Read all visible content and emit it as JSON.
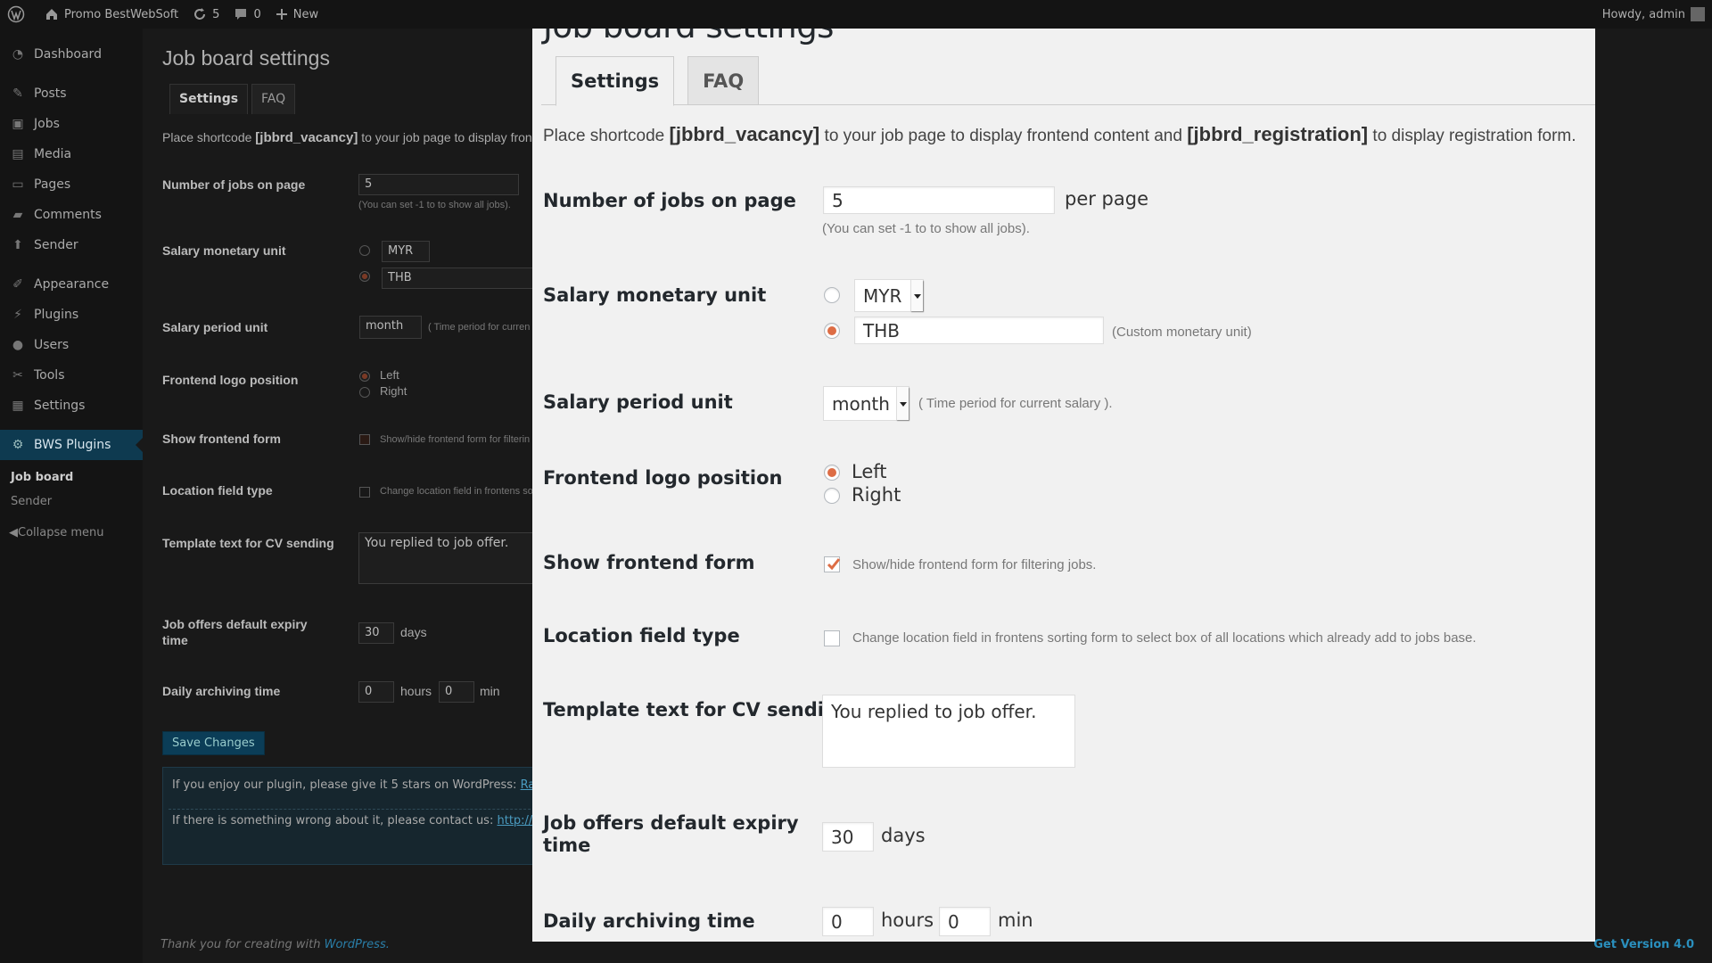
{
  "adminbar": {
    "site_name": "Promo BestWebSoft",
    "updates_count": "5",
    "comments_count": "0",
    "new_label": "New",
    "howdy": "Howdy, admin"
  },
  "sidebar": {
    "items": [
      {
        "label": "Dashboard"
      },
      {
        "label": "Posts"
      },
      {
        "label": "Jobs"
      },
      {
        "label": "Media"
      },
      {
        "label": "Pages"
      },
      {
        "label": "Comments"
      },
      {
        "label": "Sender"
      },
      {
        "label": "Appearance"
      },
      {
        "label": "Plugins"
      },
      {
        "label": "Users"
      },
      {
        "label": "Tools"
      },
      {
        "label": "Settings"
      },
      {
        "label": "BWS Plugins"
      }
    ],
    "sub_items": [
      {
        "label": "Job board"
      },
      {
        "label": "Sender"
      }
    ],
    "collapse_label": "Collapse menu"
  },
  "background": {
    "title": "Job board settings",
    "tabs": [
      "Settings",
      "FAQ"
    ],
    "desc_prefix": "Place shortcode",
    "desc_code": "[jbbrd_vacancy]",
    "desc_suffix": "to your job page to display fronte",
    "labels": {
      "jobs_on_page": "Number of jobs on page",
      "salary_unit": "Salary monetary unit",
      "salary_period": "Salary period unit",
      "logo_position": "Frontend logo position",
      "show_form": "Show frontend form",
      "location_type": "Location field type",
      "template_text": "Template text for CV sending",
      "expiry": "Job offers default expiry time",
      "archiving": "Daily archiving time"
    },
    "jobs_value": "5",
    "jobs_hint": "(You can set -1 to to show all jobs).",
    "currency_select": "MYR",
    "custom_currency": "THB",
    "period_select": "month",
    "period_hint": "( Time period for curren",
    "logo_left": "Left",
    "logo_right": "Right",
    "show_form_hint": "Show/hide frontend form for filterin",
    "location_hint": "Change location field in frontens so",
    "template_value": "You replied to job offer.",
    "expiry_value": "30",
    "expiry_unit": "days",
    "hours_value": "0",
    "hours_unit": "hours",
    "min_value": "0",
    "min_unit": "min",
    "save_button": "Save Changes",
    "note1_prefix": "If you enjoy our plugin, please give it 5 stars on WordPress:",
    "note1_link": "Rate the",
    "note2_prefix": "If there is something wrong about it, please contact us:",
    "note2_link": "http://suppo"
  },
  "modal": {
    "title": "Job board settings",
    "tabs": {
      "settings": "Settings",
      "faq": "FAQ"
    },
    "desc": {
      "prefix": "Place shortcode",
      "code1": "[jbbrd_vacancy]",
      "middle": "to your job page to display frontend content and",
      "code2": "[jbbrd_registration]",
      "suffix": "to display registration form."
    },
    "jobs_on_page": {
      "label": "Number of jobs on page",
      "value": "5",
      "unit": "per page",
      "hint": "(You can set -1 to to show all jobs)."
    },
    "salary_unit": {
      "label": "Salary monetary unit",
      "select": "MYR",
      "custom_value": "THB",
      "custom_hint": "(Custom monetary unit)"
    },
    "salary_period": {
      "label": "Salary period unit",
      "select": "month",
      "hint": "( Time period for current salary )."
    },
    "logo_position": {
      "label": "Frontend logo position",
      "left": "Left",
      "right": "Right"
    },
    "show_form": {
      "label": "Show frontend form",
      "hint": "Show/hide frontend form for filtering jobs."
    },
    "location_type": {
      "label": "Location field type",
      "hint": "Change location field in frontens sorting form to select box of all locations which already add to jobs base."
    },
    "template_text": {
      "label": "Template text for CV sending",
      "value": "You replied to job offer."
    },
    "expiry": {
      "label_line1": "Job offers default expiry",
      "label_line2": "time",
      "value": "30",
      "unit": "days"
    },
    "archiving": {
      "label": "Daily archiving time",
      "hours": "0",
      "hours_unit": "hours",
      "min": "0",
      "min_unit": "min"
    }
  },
  "footer": {
    "thanks_prefix": "Thank you for creating with",
    "thanks_link": "WordPress.",
    "version": "Get Version 4.0"
  },
  "colors": {
    "accent": "#dd6d45",
    "active_menu": "#0e3a50",
    "link": "#2a8fbd"
  }
}
